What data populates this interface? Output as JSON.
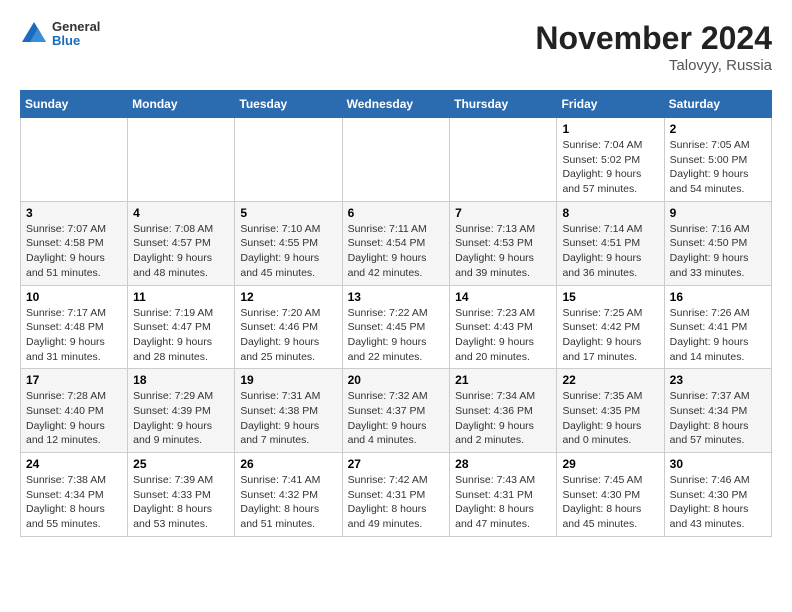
{
  "logo": {
    "general": "General",
    "blue": "Blue"
  },
  "title": "November 2024",
  "location": "Talovyy, Russia",
  "days_header": [
    "Sunday",
    "Monday",
    "Tuesday",
    "Wednesday",
    "Thursday",
    "Friday",
    "Saturday"
  ],
  "weeks": [
    [
      {
        "day": "",
        "info": ""
      },
      {
        "day": "",
        "info": ""
      },
      {
        "day": "",
        "info": ""
      },
      {
        "day": "",
        "info": ""
      },
      {
        "day": "",
        "info": ""
      },
      {
        "day": "1",
        "info": "Sunrise: 7:04 AM\nSunset: 5:02 PM\nDaylight: 9 hours\nand 57 minutes."
      },
      {
        "day": "2",
        "info": "Sunrise: 7:05 AM\nSunset: 5:00 PM\nDaylight: 9 hours\nand 54 minutes."
      }
    ],
    [
      {
        "day": "3",
        "info": "Sunrise: 7:07 AM\nSunset: 4:58 PM\nDaylight: 9 hours\nand 51 minutes."
      },
      {
        "day": "4",
        "info": "Sunrise: 7:08 AM\nSunset: 4:57 PM\nDaylight: 9 hours\nand 48 minutes."
      },
      {
        "day": "5",
        "info": "Sunrise: 7:10 AM\nSunset: 4:55 PM\nDaylight: 9 hours\nand 45 minutes."
      },
      {
        "day": "6",
        "info": "Sunrise: 7:11 AM\nSunset: 4:54 PM\nDaylight: 9 hours\nand 42 minutes."
      },
      {
        "day": "7",
        "info": "Sunrise: 7:13 AM\nSunset: 4:53 PM\nDaylight: 9 hours\nand 39 minutes."
      },
      {
        "day": "8",
        "info": "Sunrise: 7:14 AM\nSunset: 4:51 PM\nDaylight: 9 hours\nand 36 minutes."
      },
      {
        "day": "9",
        "info": "Sunrise: 7:16 AM\nSunset: 4:50 PM\nDaylight: 9 hours\nand 33 minutes."
      }
    ],
    [
      {
        "day": "10",
        "info": "Sunrise: 7:17 AM\nSunset: 4:48 PM\nDaylight: 9 hours\nand 31 minutes."
      },
      {
        "day": "11",
        "info": "Sunrise: 7:19 AM\nSunset: 4:47 PM\nDaylight: 9 hours\nand 28 minutes."
      },
      {
        "day": "12",
        "info": "Sunrise: 7:20 AM\nSunset: 4:46 PM\nDaylight: 9 hours\nand 25 minutes."
      },
      {
        "day": "13",
        "info": "Sunrise: 7:22 AM\nSunset: 4:45 PM\nDaylight: 9 hours\nand 22 minutes."
      },
      {
        "day": "14",
        "info": "Sunrise: 7:23 AM\nSunset: 4:43 PM\nDaylight: 9 hours\nand 20 minutes."
      },
      {
        "day": "15",
        "info": "Sunrise: 7:25 AM\nSunset: 4:42 PM\nDaylight: 9 hours\nand 17 minutes."
      },
      {
        "day": "16",
        "info": "Sunrise: 7:26 AM\nSunset: 4:41 PM\nDaylight: 9 hours\nand 14 minutes."
      }
    ],
    [
      {
        "day": "17",
        "info": "Sunrise: 7:28 AM\nSunset: 4:40 PM\nDaylight: 9 hours\nand 12 minutes."
      },
      {
        "day": "18",
        "info": "Sunrise: 7:29 AM\nSunset: 4:39 PM\nDaylight: 9 hours\nand 9 minutes."
      },
      {
        "day": "19",
        "info": "Sunrise: 7:31 AM\nSunset: 4:38 PM\nDaylight: 9 hours\nand 7 minutes."
      },
      {
        "day": "20",
        "info": "Sunrise: 7:32 AM\nSunset: 4:37 PM\nDaylight: 9 hours\nand 4 minutes."
      },
      {
        "day": "21",
        "info": "Sunrise: 7:34 AM\nSunset: 4:36 PM\nDaylight: 9 hours\nand 2 minutes."
      },
      {
        "day": "22",
        "info": "Sunrise: 7:35 AM\nSunset: 4:35 PM\nDaylight: 9 hours\nand 0 minutes."
      },
      {
        "day": "23",
        "info": "Sunrise: 7:37 AM\nSunset: 4:34 PM\nDaylight: 8 hours\nand 57 minutes."
      }
    ],
    [
      {
        "day": "24",
        "info": "Sunrise: 7:38 AM\nSunset: 4:34 PM\nDaylight: 8 hours\nand 55 minutes."
      },
      {
        "day": "25",
        "info": "Sunrise: 7:39 AM\nSunset: 4:33 PM\nDaylight: 8 hours\nand 53 minutes."
      },
      {
        "day": "26",
        "info": "Sunrise: 7:41 AM\nSunset: 4:32 PM\nDaylight: 8 hours\nand 51 minutes."
      },
      {
        "day": "27",
        "info": "Sunrise: 7:42 AM\nSunset: 4:31 PM\nDaylight: 8 hours\nand 49 minutes."
      },
      {
        "day": "28",
        "info": "Sunrise: 7:43 AM\nSunset: 4:31 PM\nDaylight: 8 hours\nand 47 minutes."
      },
      {
        "day": "29",
        "info": "Sunrise: 7:45 AM\nSunset: 4:30 PM\nDaylight: 8 hours\nand 45 minutes."
      },
      {
        "day": "30",
        "info": "Sunrise: 7:46 AM\nSunset: 4:30 PM\nDaylight: 8 hours\nand 43 minutes."
      }
    ]
  ]
}
